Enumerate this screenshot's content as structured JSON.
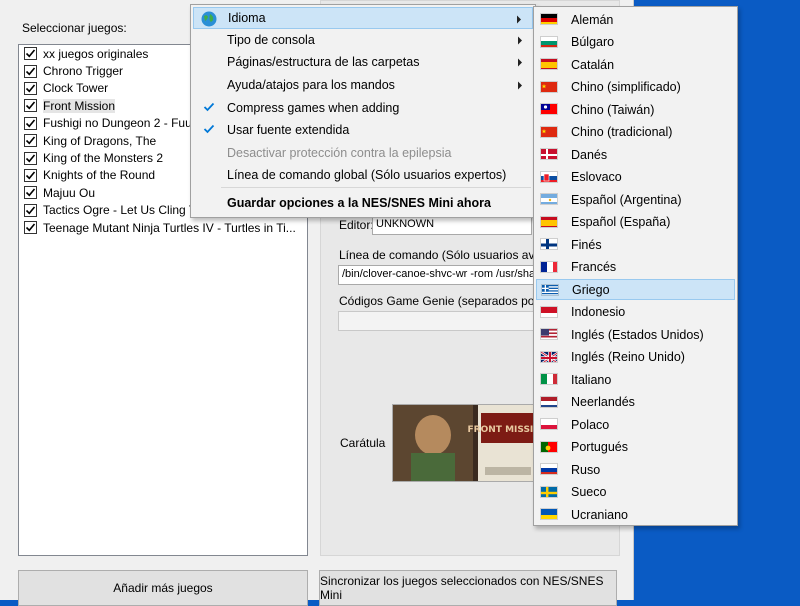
{
  "games_panel": {
    "label": "Seleccionar juegos:",
    "games": [
      {
        "name": "xx juegos originales",
        "checked": true
      },
      {
        "name": "Chrono Trigger",
        "checked": true
      },
      {
        "name": "Clock Tower",
        "checked": true
      },
      {
        "name": "Front Mission",
        "checked": true,
        "selected": true
      },
      {
        "name": "Fushigi no Dungeon 2 - Fuurai",
        "checked": true
      },
      {
        "name": "King of Dragons, The",
        "checked": true
      },
      {
        "name": "King of the Monsters 2",
        "checked": true
      },
      {
        "name": "Knights of the Round",
        "checked": true
      },
      {
        "name": "Majuu Ou",
        "checked": true
      },
      {
        "name": "Tactics Ogre - Let Us Cling Together",
        "checked": true
      },
      {
        "name": "Teenage Mutant Ninja Turtles IV - Turtles in Ti...",
        "checked": true
      }
    ]
  },
  "details": {
    "editor_label": "Editor:",
    "editor_value": "UNKNOWN",
    "command_label": "Línea de comando (Sólo usuarios avanz",
    "command_value": "/bin/clover-canoe-shvc-wr -rom /usr/sha",
    "genie_label": "Códigos Game Genie (separados por com",
    "genie_value": "",
    "cover_label": "Carátula",
    "cover_title_text": "FRONT MISSION"
  },
  "buttons": {
    "add_games": "Añadir más juegos",
    "sync": "Sincronizar los juegos seleccionados con NES/SNES Mini"
  },
  "settings_menu": {
    "items": [
      {
        "label": "Idioma",
        "submenu": true,
        "icon": "globe-icon",
        "highlighted": true
      },
      {
        "label": "Tipo de consola",
        "submenu": true
      },
      {
        "label": "Páginas/estructura de las carpetas",
        "submenu": true
      },
      {
        "label": "Ayuda/atajos para los mandos",
        "submenu": true
      },
      {
        "label": "Compress games when adding",
        "checked": true
      },
      {
        "label": "Usar fuente extendida",
        "checked": true
      },
      {
        "label": "Desactivar protección contra la epilepsia",
        "disabled": true
      },
      {
        "label": "Línea de comando global (Sólo usuarios expertos)"
      },
      {
        "label": "Guardar opciones a la NES/SNES Mini ahora",
        "bold": true
      }
    ]
  },
  "language_menu": {
    "items": [
      {
        "label": "Alemán",
        "flag": "de"
      },
      {
        "label": "Búlgaro",
        "flag": "bg"
      },
      {
        "label": "Catalán",
        "flag": "es"
      },
      {
        "label": "Chino (simplificado)",
        "flag": "cn"
      },
      {
        "label": "Chino (Taiwán)",
        "flag": "tw"
      },
      {
        "label": "Chino (tradicional)",
        "flag": "cn"
      },
      {
        "label": "Danés",
        "flag": "dk"
      },
      {
        "label": "Eslovaco",
        "flag": "sk"
      },
      {
        "label": "Español (Argentina)",
        "flag": "ar"
      },
      {
        "label": "Español (España)",
        "flag": "es"
      },
      {
        "label": "Finés",
        "flag": "fi"
      },
      {
        "label": "Francés",
        "flag": "fr"
      },
      {
        "label": "Griego",
        "flag": "gr",
        "highlighted": true
      },
      {
        "label": "Indonesio",
        "flag": "id"
      },
      {
        "label": "Inglés (Estados Unidos)",
        "flag": "us"
      },
      {
        "label": "Inglés (Reino Unido)",
        "flag": "gb"
      },
      {
        "label": "Italiano",
        "flag": "it"
      },
      {
        "label": "Neerlandés",
        "flag": "nl"
      },
      {
        "label": "Polaco",
        "flag": "pl"
      },
      {
        "label": "Portugués",
        "flag": "pt"
      },
      {
        "label": "Ruso",
        "flag": "ru"
      },
      {
        "label": "Sueco",
        "flag": "se"
      },
      {
        "label": "Ucraniano",
        "flag": "ua"
      }
    ]
  },
  "colors": {
    "desktop": "#0a5bc4",
    "highlight_bg": "#cce4f7",
    "highlight_border": "#99c9ef",
    "check_blue": "#0078d7",
    "menu_bg": "#f2f2f2"
  }
}
